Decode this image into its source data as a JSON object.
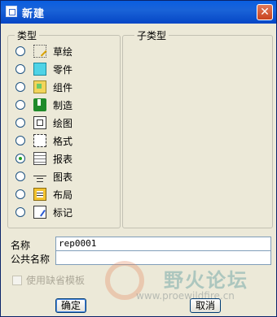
{
  "title": "新建",
  "groups": {
    "type_label": "类型",
    "subtype_label": "子类型"
  },
  "types": [
    {
      "label": "草绘",
      "icon": "sketch-icon",
      "checked": false
    },
    {
      "label": "零件",
      "icon": "part-icon",
      "checked": false
    },
    {
      "label": "组件",
      "icon": "assembly-icon",
      "checked": false
    },
    {
      "label": "制造",
      "icon": "manufacturing-icon",
      "checked": false
    },
    {
      "label": "绘图",
      "icon": "drawing-icon",
      "checked": false
    },
    {
      "label": "格式",
      "icon": "format-icon",
      "checked": false
    },
    {
      "label": "报表",
      "icon": "report-icon",
      "checked": true
    },
    {
      "label": "图表",
      "icon": "diagram-icon",
      "checked": false
    },
    {
      "label": "布局",
      "icon": "layout-icon",
      "checked": false
    },
    {
      "label": "标记",
      "icon": "markup-icon",
      "checked": false
    }
  ],
  "fields": {
    "name_label": "名称",
    "name_value": "rep0001",
    "common_name_label": "公共名称",
    "common_name_value": ""
  },
  "use_default_template_label": "使用缺省模板",
  "watermark": {
    "text": "野火论坛",
    "url": "www.proewildfire.cn"
  },
  "buttons": {
    "ok": "确定",
    "cancel": "取消"
  },
  "colors": {
    "titlebar": "#0a5ee0",
    "selected_radio": "#21a121"
  }
}
